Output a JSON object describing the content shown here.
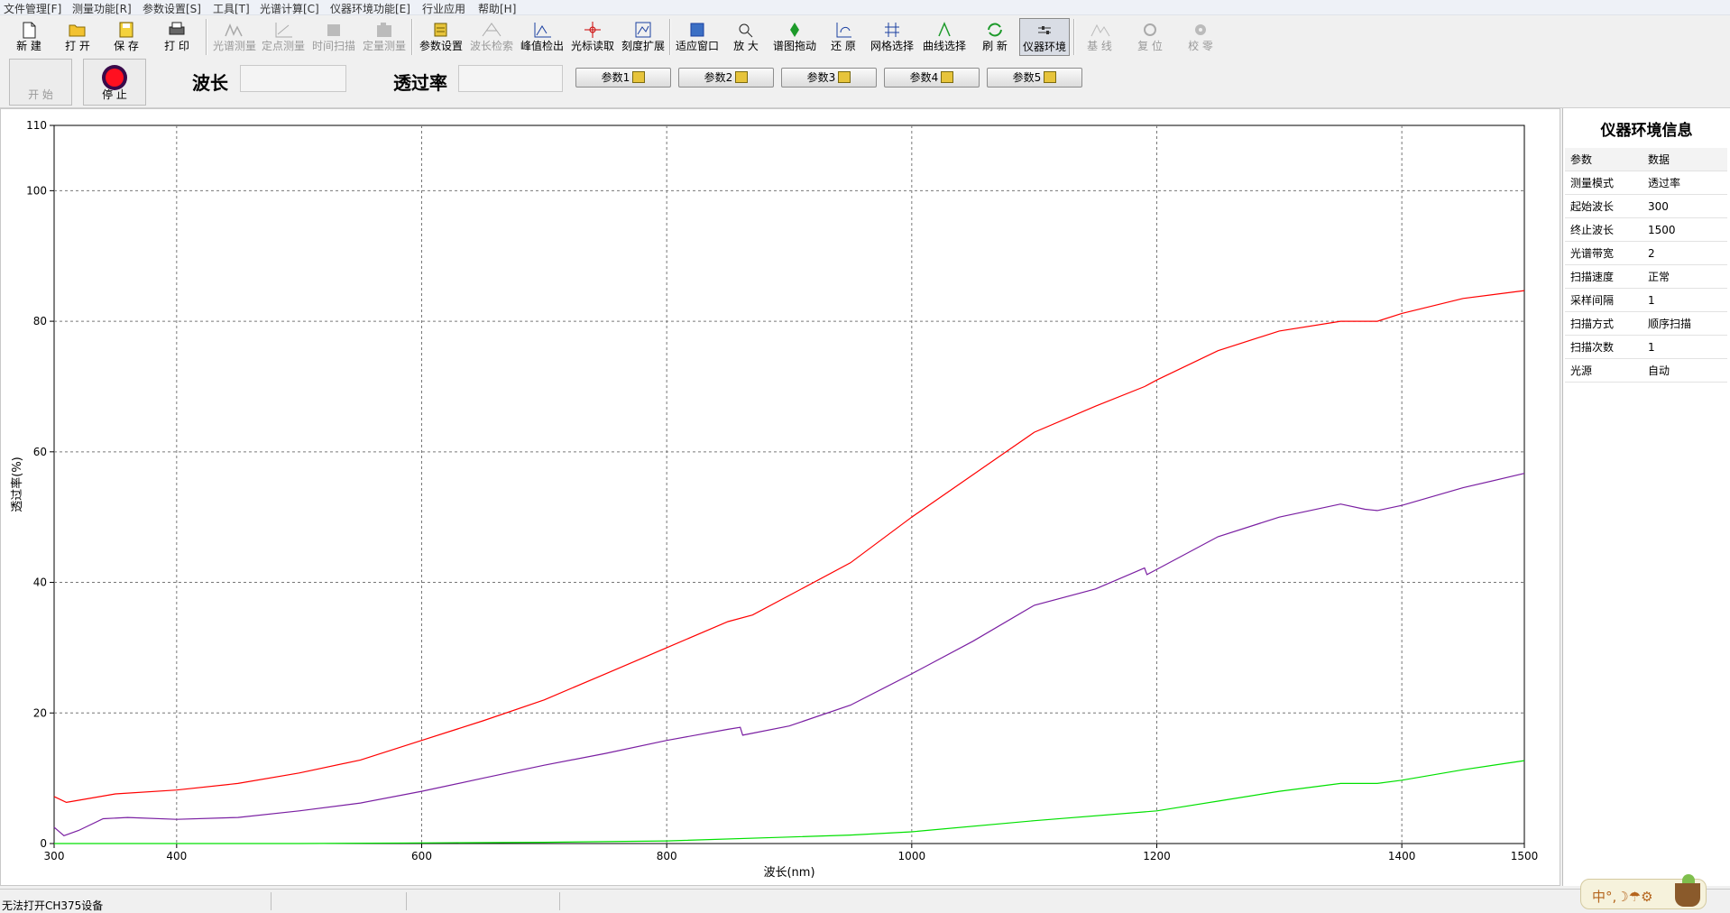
{
  "menu": [
    "文件管理[F]",
    "测量功能[R]",
    "参数设置[S]",
    "工具[T]",
    "光谱计算[C]",
    "仪器环境功能[E]",
    "行业应用",
    "帮助[H]"
  ],
  "toolbar": {
    "new": "新  建",
    "open": "打  开",
    "save": "保  存",
    "print": "打  印",
    "spectrum_measure": "光谱测量",
    "point_measure": "定点测量",
    "time_scan": "时间扫描",
    "quant_measure": "定量测量",
    "param_settings": "参数设置",
    "wavelength_search": "波长检索",
    "peak_detect": "峰值检出",
    "cursor_read": "光标读取",
    "scale_expand": "刻度扩展",
    "fit_window": "适应窗口",
    "zoom_in": "放  大",
    "drag": "谱图拖动",
    "restore": "还  原",
    "grid_select": "网格选择",
    "curve_select": "曲线选择",
    "refresh": "刷  新",
    "instrument_env": "仪器环境",
    "baseline": "基  线",
    "reset": "复  位",
    "calibrate": "校  零"
  },
  "controls": {
    "start": "开  始",
    "stop": "停  止",
    "wavelength_label": "波长",
    "wavelength_value": "",
    "transmittance_label": "透过率",
    "transmittance_value": "",
    "params": [
      "参数1",
      "参数2",
      "参数3",
      "参数4",
      "参数5"
    ]
  },
  "info_panel": {
    "title": "仪器环境信息",
    "header": [
      "参数",
      "数据"
    ],
    "rows": [
      [
        "测量模式",
        "透过率"
      ],
      [
        "起始波长",
        "300"
      ],
      [
        "终止波长",
        "1500"
      ],
      [
        "光谱带宽",
        "2"
      ],
      [
        "扫描速度",
        "正常"
      ],
      [
        "采样间隔",
        "1"
      ],
      [
        "扫描方式",
        "顺序扫描"
      ],
      [
        "扫描次数",
        "1"
      ],
      [
        "光源",
        "自动"
      ]
    ]
  },
  "status": {
    "text": "无法打开CH375设备",
    "ime": "中°,☽☂⚙"
  },
  "colors": {
    "red": "#ff0000",
    "purple": "#7a1fa2",
    "green": "#00e000",
    "active": "#d9dde5"
  },
  "chart_data": {
    "type": "line",
    "xlabel": "波长(nm)",
    "ylabel": "透过率(%)",
    "xlim": [
      300,
      1500
    ],
    "ylim": [
      0,
      110
    ],
    "xticks": [
      300,
      400,
      600,
      800,
      1000,
      1200,
      1400,
      1500
    ],
    "yticks": [
      0,
      20,
      40,
      60,
      80,
      100,
      110
    ],
    "grid": true,
    "series": [
      {
        "color": "#ff0000",
        "points": [
          [
            300,
            7.2
          ],
          [
            310,
            6.3
          ],
          [
            350,
            7.6
          ],
          [
            400,
            8.2
          ],
          [
            450,
            9.2
          ],
          [
            500,
            10.8
          ],
          [
            550,
            12.8
          ],
          [
            600,
            15.8
          ],
          [
            650,
            18.8
          ],
          [
            700,
            22.0
          ],
          [
            750,
            26.0
          ],
          [
            800,
            30.0
          ],
          [
            850,
            34.0
          ],
          [
            870,
            35.0
          ],
          [
            900,
            38.0
          ],
          [
            950,
            43.0
          ],
          [
            1000,
            50.0
          ],
          [
            1050,
            56.5
          ],
          [
            1100,
            63.0
          ],
          [
            1150,
            67.0
          ],
          [
            1190,
            70.0
          ],
          [
            1200,
            71.0
          ],
          [
            1250,
            75.5
          ],
          [
            1300,
            78.5
          ],
          [
            1350,
            80.0
          ],
          [
            1380,
            80.0
          ],
          [
            1400,
            81.2
          ],
          [
            1450,
            83.5
          ],
          [
            1500,
            84.7
          ]
        ]
      },
      {
        "color": "#7a1fa2",
        "points": [
          [
            300,
            2.5
          ],
          [
            308,
            1.2
          ],
          [
            320,
            2.0
          ],
          [
            340,
            3.8
          ],
          [
            360,
            4.0
          ],
          [
            400,
            3.7
          ],
          [
            450,
            4.0
          ],
          [
            500,
            5.0
          ],
          [
            550,
            6.2
          ],
          [
            600,
            8.0
          ],
          [
            650,
            10.0
          ],
          [
            700,
            12.0
          ],
          [
            750,
            13.8
          ],
          [
            800,
            15.8
          ],
          [
            850,
            17.5
          ],
          [
            860,
            17.8
          ],
          [
            862,
            16.6
          ],
          [
            900,
            18.0
          ],
          [
            950,
            21.2
          ],
          [
            1000,
            26.0
          ],
          [
            1050,
            31.0
          ],
          [
            1100,
            36.5
          ],
          [
            1150,
            39.0
          ],
          [
            1190,
            42.2
          ],
          [
            1192,
            41.2
          ],
          [
            1200,
            42.0
          ],
          [
            1250,
            47.0
          ],
          [
            1300,
            50.0
          ],
          [
            1350,
            52.0
          ],
          [
            1370,
            51.2
          ],
          [
            1380,
            51.0
          ],
          [
            1400,
            51.8
          ],
          [
            1450,
            54.5
          ],
          [
            1500,
            56.7
          ]
        ]
      },
      {
        "color": "#00e000",
        "points": [
          [
            300,
            0.0
          ],
          [
            400,
            0.0
          ],
          [
            500,
            0.0
          ],
          [
            600,
            0.1
          ],
          [
            700,
            0.2
          ],
          [
            800,
            0.4
          ],
          [
            900,
            1.0
          ],
          [
            950,
            1.3
          ],
          [
            1000,
            1.8
          ],
          [
            1100,
            3.5
          ],
          [
            1200,
            5.0
          ],
          [
            1250,
            6.5
          ],
          [
            1300,
            8.0
          ],
          [
            1350,
            9.2
          ],
          [
            1380,
            9.2
          ],
          [
            1400,
            9.7
          ],
          [
            1450,
            11.3
          ],
          [
            1500,
            12.7
          ]
        ]
      }
    ]
  }
}
